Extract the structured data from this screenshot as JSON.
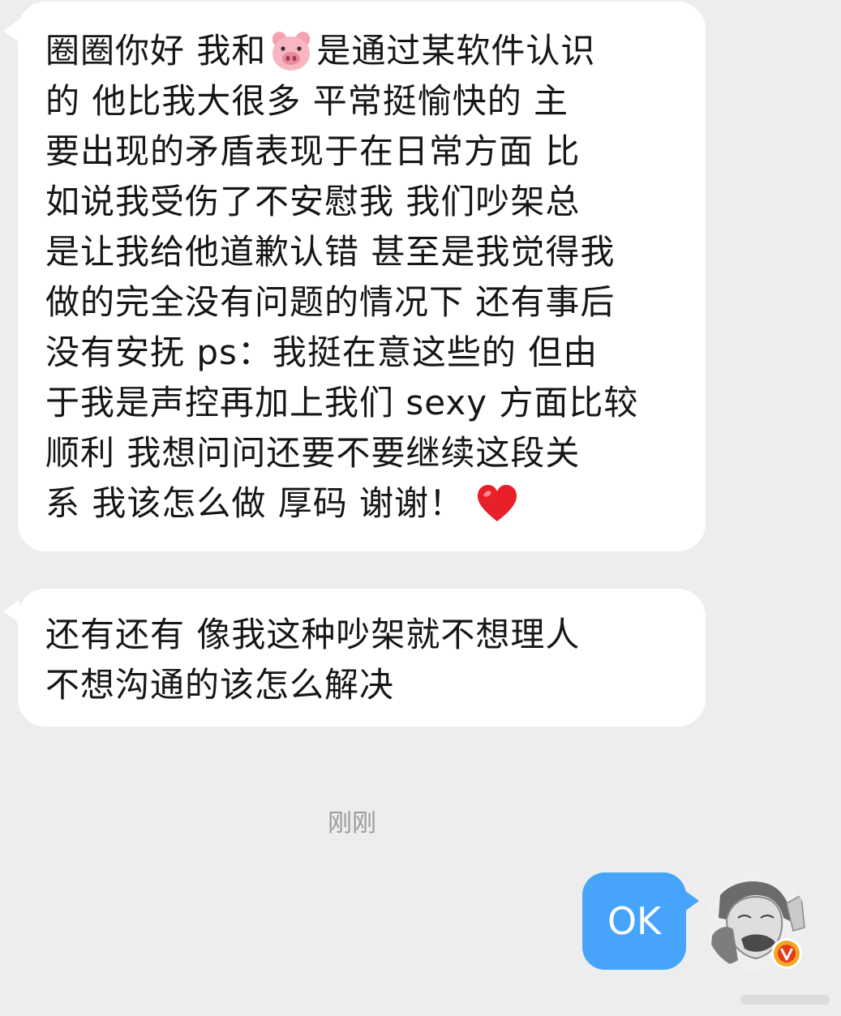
{
  "messages": [
    {
      "sender": "incoming",
      "lines": [
        [
          "圈圈你好   我和",
          "是通过某软件认识"
        ],
        [
          "的  他比我大很多  平常挺愉快的  主"
        ],
        [
          "要出现的矛盾表现于在日常方面  比"
        ],
        [
          "如说我受伤了不安慰我  我们吵架总"
        ],
        [
          "是让我给他道歉认错 甚至是我觉得我"
        ],
        [
          "做的完全没有问题的情况下 还有事后"
        ],
        [
          "没有安抚 ps：我挺在意这些的 但由"
        ],
        [
          "于我是声控再加上我们 sexy 方面比较"
        ],
        [
          "顺利  我想问问还要不要继续这段关"
        ],
        [
          "系  我该怎么做  厚码 谢谢！"
        ]
      ],
      "emojis": [
        "pig-face",
        "red-heart"
      ]
    },
    {
      "sender": "incoming",
      "lines": [
        [
          "还有还有 像我这种吵架就不想理人"
        ],
        [
          "不想沟通的该怎么解决"
        ]
      ]
    }
  ],
  "timestamp": "刚刚",
  "reply": {
    "sender": "outgoing",
    "text": "OK"
  },
  "colors": {
    "background": "#ededed",
    "incoming_bubble": "#ffffff",
    "outgoing_bubble": "#46a5fb",
    "timestamp": "#9b9b9b",
    "verified_badge": "#f5a623"
  }
}
